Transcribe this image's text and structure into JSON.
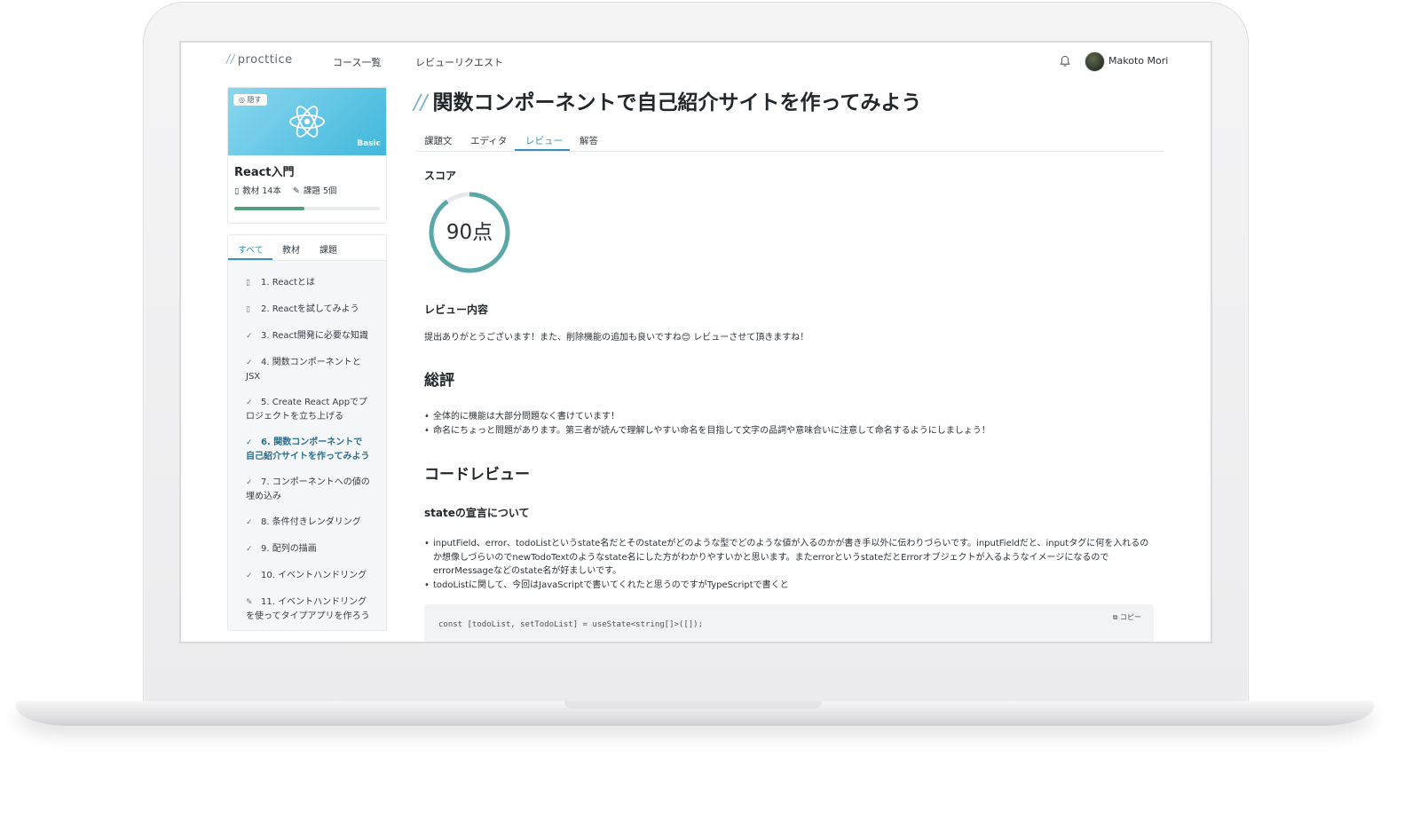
{
  "header": {
    "logo_slash": "//",
    "logo_text": "procttice",
    "nav": [
      "コース一覧",
      "レビューリクエスト"
    ],
    "user_name": "Makoto Mori"
  },
  "course": {
    "hide_label": "隠す",
    "level": "Basic",
    "title": "React入門",
    "materials": "教材 14本",
    "assignments": "課題 5個",
    "progress": 0.48
  },
  "lesson_tabs": [
    "すべて",
    "教材",
    "課題"
  ],
  "lessons": [
    {
      "icon": "book-icon",
      "glyph": "▯",
      "label": "1. Reactとは"
    },
    {
      "icon": "book-icon",
      "glyph": "▯",
      "label": "2. Reactを試してみよう"
    },
    {
      "icon": "check-icon",
      "glyph": "✓",
      "label": "3. React開発に必要な知識"
    },
    {
      "icon": "check-icon",
      "glyph": "✓",
      "label": "4. 関数コンポーネントとJSX"
    },
    {
      "icon": "check-icon",
      "glyph": "✓",
      "label": "5. Create React Appでプロジェクトを立ち上げる"
    },
    {
      "icon": "check-icon",
      "glyph": "✓",
      "label": "6. 関数コンポーネントで自己紹介サイトを作ってみよう",
      "current": true
    },
    {
      "icon": "check-icon",
      "glyph": "✓",
      "label": "7. コンポーネントへの値の埋め込み"
    },
    {
      "icon": "check-icon",
      "glyph": "✓",
      "label": "8. 条件付きレンダリング"
    },
    {
      "icon": "check-icon",
      "glyph": "✓",
      "label": "9. 配列の描画"
    },
    {
      "icon": "check-icon",
      "glyph": "✓",
      "label": "10. イベントハンドリング"
    },
    {
      "icon": "pencil-icon",
      "glyph": "✎",
      "label": "11. イベントハンドリングを使ってタイプアプリを作ろう"
    }
  ],
  "page": {
    "title_slash": "//",
    "title": "関数コンポーネントで自己紹介サイトを作ってみよう",
    "tabs": [
      "課題文",
      "エディタ",
      "レビュー",
      "解答"
    ],
    "active_tab": 2
  },
  "review": {
    "score_heading": "スコア",
    "score_value": 90,
    "score_max": 100,
    "score_label": "90点",
    "content_heading": "レビュー内容",
    "intro": "提出ありがとうございます！また、削除機能の追加も良いですね😊 レビューさせて頂きますね！",
    "summary_heading": "総評",
    "summary_points": [
      "全体的に機能は大部分問題なく書けています！",
      "命名にちょっと問題があります。第三者が読んで理解しやすい命名を目指して文字の品詞や意味合いに注意して命名するようにしましょう！"
    ],
    "code_review_heading": "コードレビュー",
    "state_heading": "stateの宣言について",
    "state_points": [
      "inputField、error、todoListというstate名だとそのstateがどのような型でどのような値が入るのかが書き手以外に伝わりづらいです。inputFieldだと、inputタグに何を入れるのか想像しづらいのでnewTodoTextのようなstate名にした方がわかりやすいかと思います。またerrorというstateだとErrorオブジェクトが入るようなイメージになるのでerrorMessageなどのstate名が好ましいです。",
      "todoListに関して、今回はJavaScriptで書いてくれたと思うのですがTypeScriptで書くと"
    ],
    "code": "const [todoList, setTodoList] = useState<string[]>([]);",
    "copy_label": "コピー"
  },
  "colors": {
    "accent": "#3a8fb4",
    "score_ring": "#5aa7a8",
    "progress": "#55a07a"
  }
}
